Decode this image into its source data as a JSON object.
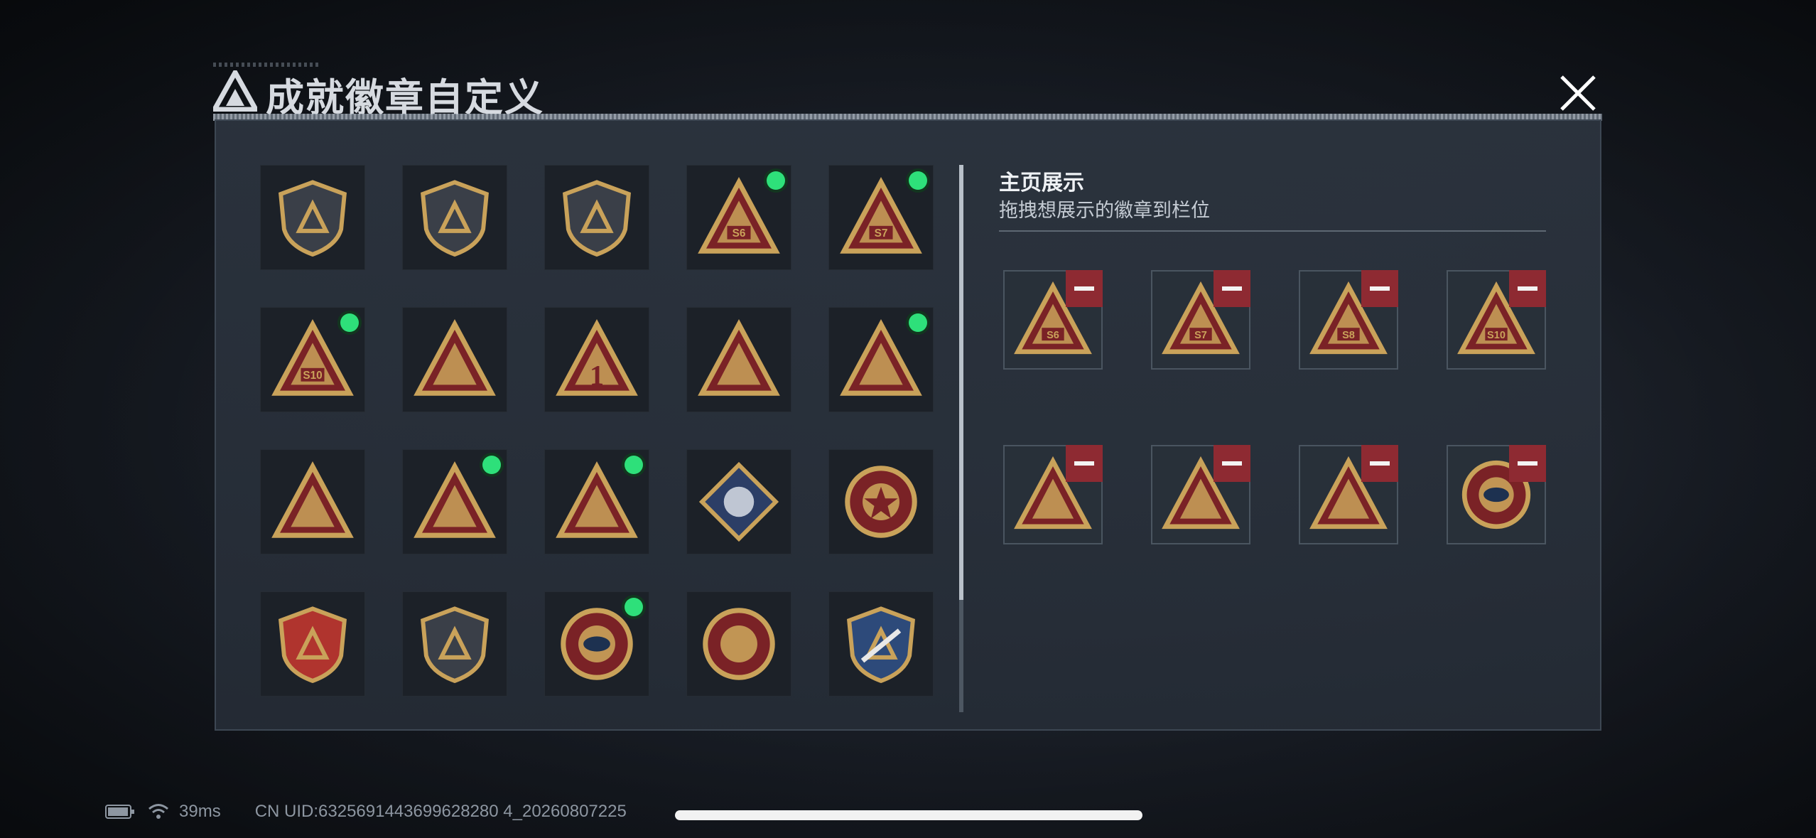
{
  "header": {
    "title": "成就徽章自定义",
    "brand_icon": "triangle-logo-icon",
    "close_icon": "close-icon"
  },
  "right_panel": {
    "title": "主页展示",
    "subtitle": "拖拽想展示的徽章到栏位"
  },
  "badges": [
    {
      "icon": "shield-triangle-icon",
      "equipped": false
    },
    {
      "icon": "shield-helicopter-icon",
      "equipped": false
    },
    {
      "icon": "shield-dagger-icon",
      "equipped": false
    },
    {
      "icon": "triangle-s6-icon",
      "equipped": true
    },
    {
      "icon": "triangle-s7-icon",
      "equipped": true
    },
    {
      "icon": "triangle-s8-icon",
      "equipped": true
    },
    {
      "icon": "triangle-s10-icon",
      "equipped": true
    },
    {
      "icon": "triangle-boat-icon",
      "equipped": false
    },
    {
      "icon": "triangle-number-one-icon",
      "equipped": false
    },
    {
      "icon": "triangle-usb-icon",
      "equipped": false
    },
    {
      "icon": "triangle-kneeling-soldier-icon",
      "equipped": true
    },
    {
      "icon": "triangle-hands-diamond-icon",
      "equipped": false
    },
    {
      "icon": "triangle-soldiers-icon",
      "equipped": false
    },
    {
      "icon": "triangle-beast-icon",
      "equipped": true
    },
    {
      "icon": "triangle-rocket-icon",
      "equipped": true
    },
    {
      "icon": "diamond-rose-icon",
      "equipped": false
    },
    {
      "icon": "circle-star-icon",
      "equipped": false
    },
    {
      "icon": "green-shield-icon",
      "equipped": false
    },
    {
      "icon": "red-shield-stars-icon",
      "equipped": false
    },
    {
      "icon": "shield-gem-icon",
      "equipped": false
    },
    {
      "icon": "circle-eye-icon",
      "equipped": true
    },
    {
      "icon": "circle-crosshair-icon",
      "equipped": false
    },
    {
      "icon": "blue-shield-rifle-icon",
      "equipped": false
    },
    {
      "icon": "shield-rifle-icon",
      "equipped": false
    },
    {
      "icon": "green-shield-rifle-icon",
      "equipped": false
    },
    {
      "icon": "circle-sniper-icon",
      "equipped": false
    },
    {
      "icon": "blue-shield-sniper-icon",
      "equipped": false
    },
    {
      "icon": "diamond-wolf-icon",
      "equipped": false
    },
    {
      "icon": "diamond-wolf-roar-icon",
      "equipped": false
    },
    {
      "icon": "diamond-horse-icon",
      "equipped": false
    }
  ],
  "showcase": [
    {
      "icon": "triangle-s6-icon"
    },
    {
      "icon": "triangle-s7-icon"
    },
    {
      "icon": "triangle-s8-icon"
    },
    {
      "icon": "triangle-s10-icon"
    },
    {
      "icon": "triangle-rocket-icon"
    },
    {
      "icon": "triangle-beast-icon"
    },
    {
      "icon": "triangle-kneeling-soldier-icon"
    },
    {
      "icon": "circle-eye-icon"
    }
  ],
  "remove_icon": "minus-icon",
  "status": {
    "battery_icon": "battery-icon",
    "wifi_icon": "wifi-icon",
    "ping": "39ms",
    "uid": "CN UID:6325691443699628280 4_20260807225"
  },
  "colors": {
    "equipped_dot": "#2ee07a",
    "remove": "#8e2a32",
    "gold": "#c9a25a",
    "badge_red": "#7a2226"
  }
}
